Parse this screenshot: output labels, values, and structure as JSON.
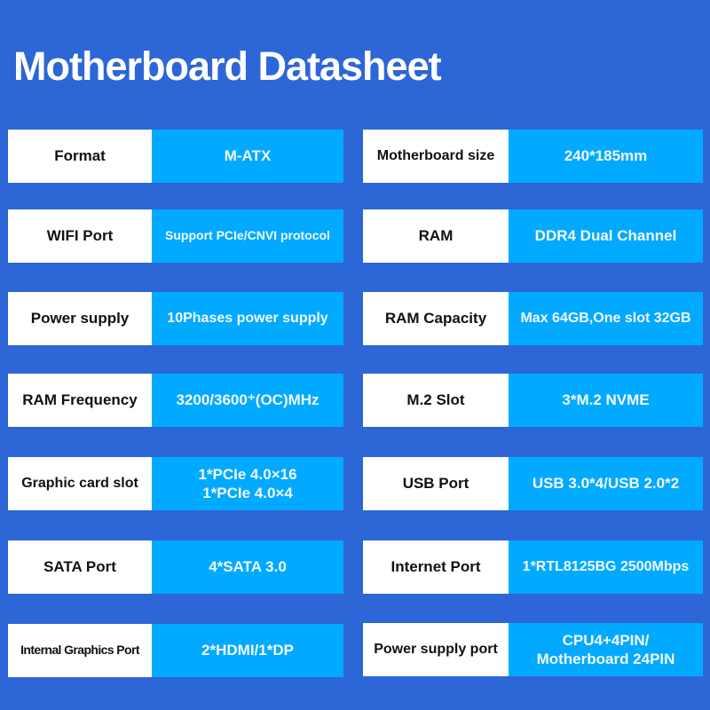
{
  "title": "Motherboard Datasheet",
  "colors": {
    "background": "#2d66d6",
    "label_bg": "#ffffff",
    "value_bg": "#02aaff",
    "label_text": "#111111",
    "value_text": "#f2f8ff"
  },
  "left_column": [
    {
      "label": "Format",
      "value": "M-ATX"
    },
    {
      "label": "WIFI Port",
      "value": "Support PCIe/CNVI protocol"
    },
    {
      "label": "Power supply",
      "value": "10Phases power supply"
    },
    {
      "label": "RAM Frequency",
      "value": "3200/3600⁺(OC)MHz"
    },
    {
      "label": "Graphic card slot",
      "value": "1*PCIe 4.0×16\n1*PCIe 4.0×4"
    },
    {
      "label": "SATA Port",
      "value": "4*SATA 3.0"
    },
    {
      "label": "Internal Graphics Port",
      "value": "2*HDMI/1*DP"
    }
  ],
  "right_column": [
    {
      "label": "Motherboard size",
      "value": "240*185mm"
    },
    {
      "label": "RAM",
      "value": "DDR4 Dual Channel"
    },
    {
      "label": "RAM Capacity",
      "value": "Max 64GB,One slot 32GB"
    },
    {
      "label": "M.2 Slot",
      "value": "3*M.2 NVME"
    },
    {
      "label": "USB Port",
      "value": "USB 3.0*4/USB 2.0*2"
    },
    {
      "label": "Internet Port",
      "value": "1*RTL8125BG 2500Mbps"
    },
    {
      "label": "Power supply port",
      "value": "CPU4+4PIN/\nMotherboard 24PIN"
    }
  ]
}
